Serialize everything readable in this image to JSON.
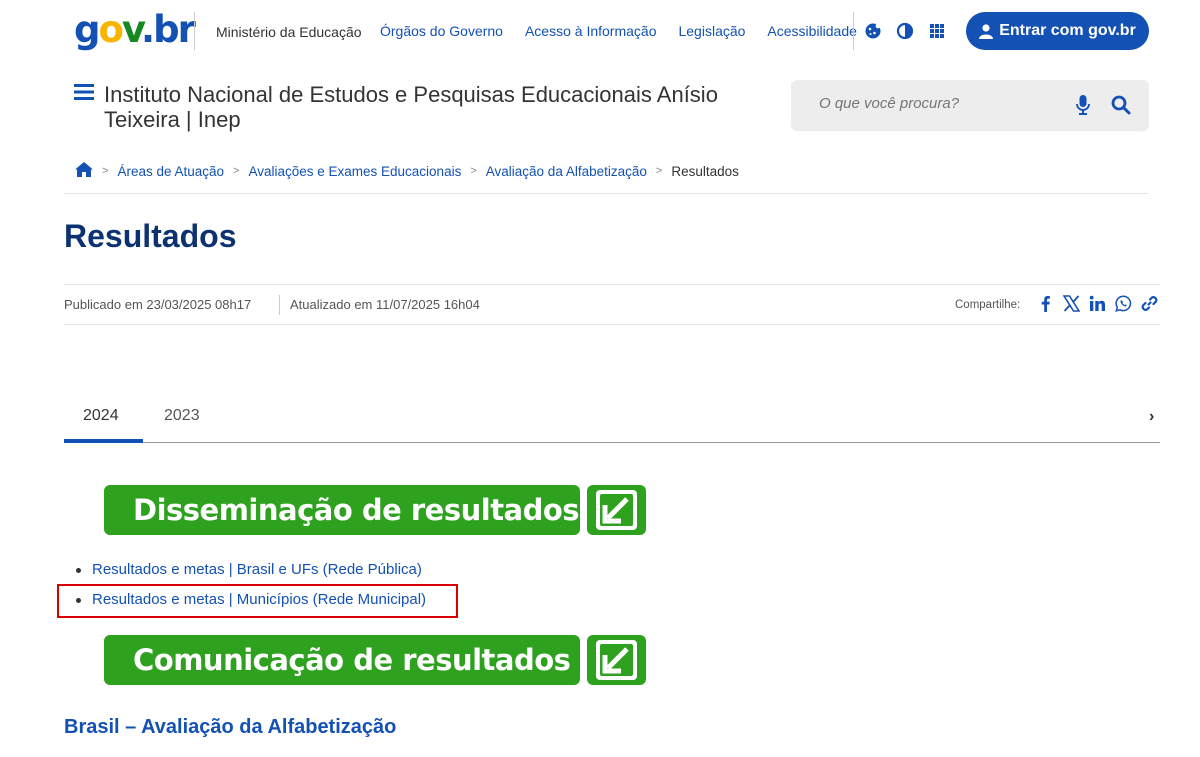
{
  "header": {
    "logo": {
      "g": "g",
      "o": "o",
      "v": "v",
      "dot": ".",
      "br": "br"
    },
    "ministry": "Ministério da Educação",
    "links": [
      "Órgãos do Governo",
      "Acesso à Informação",
      "Legislação",
      "Acessibilidade"
    ],
    "icons": [
      "cookie-icon",
      "contrast-icon",
      "apps-grid-icon"
    ],
    "login_label": "Entrar com gov.br",
    "colors": {
      "brand_blue": "#1351b4",
      "gold": "#f8b500",
      "green": "#168821"
    }
  },
  "institution": {
    "title": "Instituto Nacional de Estudos e Pesquisas Educacionais Anísio Teixeira | Inep",
    "search_placeholder": "O que você procura?"
  },
  "breadcrumb": {
    "items": [
      "Áreas de Atuação",
      "Avaliações e Exames Educacionais",
      "Avaliação da Alfabetização"
    ],
    "current": "Resultados"
  },
  "page": {
    "title": "Resultados",
    "published": "Publicado em 23/03/2025 08h17",
    "updated": "Atualizado em 11/07/2025 16h04",
    "share_label": "Compartilhe:",
    "share_icons": [
      "facebook-icon",
      "x-icon",
      "linkedin-icon",
      "whatsapp-icon",
      "link-icon"
    ]
  },
  "tabs": {
    "items": [
      "2024",
      "2023"
    ],
    "active": "2024"
  },
  "content": {
    "banner1": "Disseminação de resultados",
    "links": [
      "Resultados e metas | Brasil e UFs (Rede Pública)",
      "Resultados e metas | Municípios (Rede Municipal)"
    ],
    "banner2": "Comunicação de resultados",
    "subtitle": "Brasil – Avaliação da Alfabetização",
    "accent_green": "#2ea11f",
    "highlight_color": "#d80000"
  }
}
